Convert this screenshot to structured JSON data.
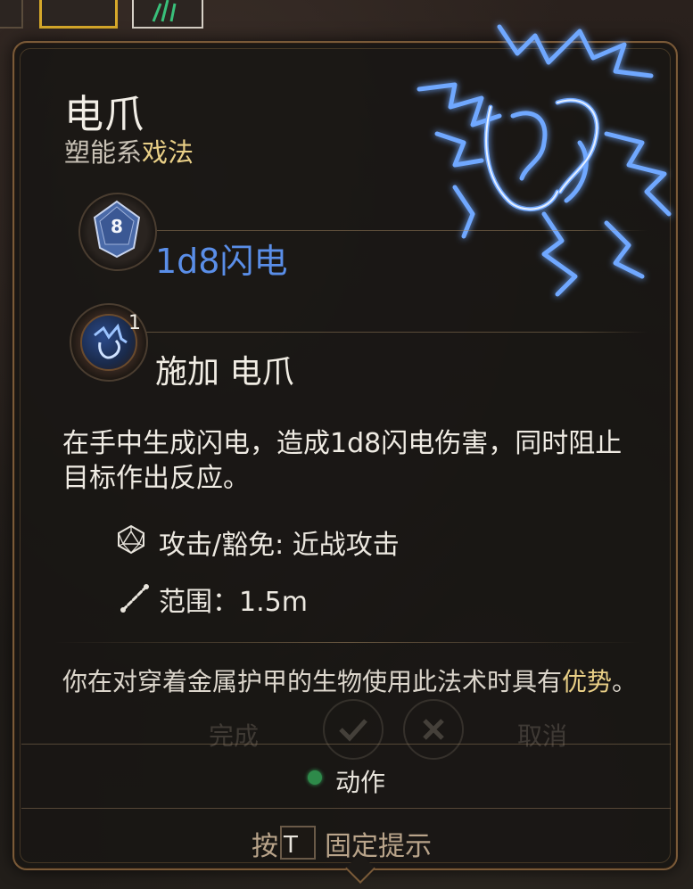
{
  "spell": {
    "name": "电爪",
    "school_prefix": "塑能系",
    "school_type": "戏法",
    "damage_die": "8",
    "damage": "1d8闪电",
    "cast_count": "1",
    "cast_label": "施加 电爪",
    "description": "在手中生成闪电，造成1d8闪电伤害，同时阻止目标作出反应。",
    "attack_save": "攻击/豁免: 近战攻击",
    "range": "范围：1.5m",
    "note_prefix": "你在对穿着金属护甲的生物使用此法术时具有",
    "note_highlight": "优势",
    "note_suffix": "。",
    "action_type": "动作"
  },
  "background": {
    "confirm_label": "完成",
    "cancel_label": "取消"
  },
  "hint": {
    "prefix": "按",
    "key": "T",
    "suffix": "固定提示"
  },
  "colors": {
    "damage": "#5a8ee8",
    "highlight": "#e9cf86",
    "action_dot": "#2e8a4a",
    "border": "#7a5a38"
  }
}
